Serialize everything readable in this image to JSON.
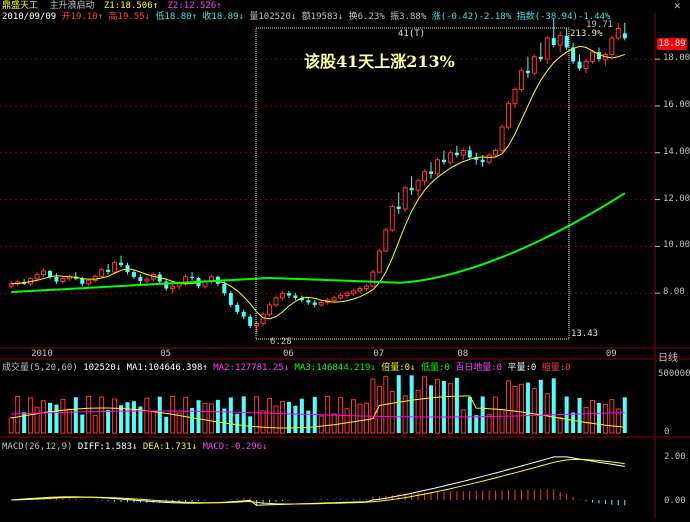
{
  "header": {
    "stock_name": "鼎盛天工",
    "indicator_name": "主升浪启动",
    "z1": "Z1:18.506↑",
    "z2": "Z2:12.526↑",
    "date": "2010/09/09",
    "open": "开19.10↑",
    "high": "高19.55↓",
    "low": "低18.80↑",
    "close": "收18.89↓",
    "volume": "量102520↓",
    "amount": "额19583↓",
    "turnover": "换6.23%",
    "amplitude": "振3.88%",
    "change": "涨(-0.42)-2.18%",
    "index": "指数(-38.94)-1.44%"
  },
  "annotation": {
    "title": "该股41天上涨213%",
    "days_label": "41(T)",
    "pct_label": "213.9%",
    "high_value": "19.71",
    "low_value": "6.28",
    "bottom_value": "13.43"
  },
  "price_tag": "18.89",
  "price_axis_labels": [
    "18.00",
    "16.00",
    "14.00",
    "12.00",
    "10.00",
    "8.00"
  ],
  "date_axis": {
    "labels": [
      "2010",
      "05",
      "06",
      "07",
      "08",
      "09"
    ],
    "period_label": "日线"
  },
  "volume_header": {
    "name": "成交量(5,20,60)",
    "value": "102520↓",
    "ma1": "MA1:104646.398↑",
    "ma2": "MA2:127781.25↓",
    "ma3": "MA3:146844.219↓",
    "bei": "倍量:0↓",
    "di": "低量:0",
    "bai": "百日地量:0",
    "ping": "平量:0",
    "suo": "缩量:0"
  },
  "volume_axis_labels": [
    "500000",
    "0"
  ],
  "macd_header": {
    "name": "MACD(26,12,9)",
    "diff": "DIFF:1.583↓",
    "dea": "DEA:1.731↓",
    "macd": "MACD:-0.296↓"
  },
  "macd_axis_labels": [
    "2.00",
    "0.00"
  ],
  "colors": {
    "up": "#ff3232",
    "down": "#54fcfc",
    "ma_yellow": "#ffff00",
    "ma_green": "#00ff00",
    "ma_purple": "#ff00ff",
    "grid": "#8b0000",
    "annotation_box": "#e8e8b0"
  },
  "chart_data": {
    "type": "candlestick",
    "x_axis_labels": [
      "2010",
      "05",
      "06",
      "07",
      "08",
      "09"
    ],
    "y_axis_ticks": [
      8,
      10,
      12,
      14,
      16,
      18
    ],
    "ylim": [
      6,
      19.8
    ],
    "ohlc": [
      [
        8.3,
        8.52,
        8.2,
        8.4
      ],
      [
        8.4,
        8.55,
        8.3,
        8.48
      ],
      [
        8.48,
        8.6,
        8.35,
        8.4
      ],
      [
        8.4,
        8.7,
        8.3,
        8.62
      ],
      [
        8.62,
        8.9,
        8.5,
        8.8
      ],
      [
        8.8,
        9.05,
        8.7,
        8.95
      ],
      [
        8.95,
        9.0,
        8.6,
        8.7
      ],
      [
        8.7,
        8.85,
        8.4,
        8.5
      ],
      [
        8.5,
        8.7,
        8.4,
        8.62
      ],
      [
        8.62,
        8.8,
        8.5,
        8.7
      ],
      [
        8.7,
        8.9,
        8.55,
        8.62
      ],
      [
        8.62,
        8.7,
        8.3,
        8.4
      ],
      [
        8.4,
        8.6,
        8.3,
        8.55
      ],
      [
        8.55,
        8.8,
        8.45,
        8.72
      ],
      [
        8.72,
        9.1,
        8.65,
        9.0
      ],
      [
        9.0,
        9.25,
        8.8,
        8.9
      ],
      [
        8.9,
        9.4,
        8.85,
        9.3
      ],
      [
        9.3,
        9.6,
        9.1,
        9.2
      ],
      [
        9.2,
        9.3,
        8.8,
        8.9
      ],
      [
        8.9,
        9.0,
        8.6,
        8.7
      ],
      [
        8.7,
        8.8,
        8.4,
        8.52
      ],
      [
        8.52,
        8.7,
        8.3,
        8.6
      ],
      [
        8.6,
        8.9,
        8.5,
        8.8
      ],
      [
        8.8,
        8.9,
        8.4,
        8.5
      ],
      [
        8.5,
        8.6,
        8.1,
        8.2
      ],
      [
        8.2,
        8.4,
        8.0,
        8.3
      ],
      [
        8.3,
        8.5,
        8.15,
        8.4
      ],
      [
        8.4,
        8.8,
        8.3,
        8.7
      ],
      [
        8.7,
        8.9,
        8.55,
        8.65
      ],
      [
        8.65,
        8.7,
        8.2,
        8.3
      ],
      [
        8.3,
        8.6,
        8.2,
        8.5
      ],
      [
        8.5,
        8.8,
        8.4,
        8.7
      ],
      [
        8.7,
        8.75,
        8.3,
        8.4
      ],
      [
        8.4,
        8.5,
        7.9,
        8.0
      ],
      [
        8.0,
        8.1,
        7.4,
        7.5
      ],
      [
        7.5,
        7.6,
        7.1,
        7.2
      ],
      [
        7.2,
        7.3,
        6.9,
        7.0
      ],
      [
        7.0,
        7.1,
        6.5,
        6.6
      ],
      [
        6.6,
        6.8,
        6.28,
        6.7
      ],
      [
        6.7,
        7.2,
        6.6,
        7.1
      ],
      [
        7.1,
        7.6,
        7.0,
        7.5
      ],
      [
        7.5,
        7.9,
        7.4,
        7.8
      ],
      [
        7.8,
        8.1,
        7.7,
        8.0
      ],
      [
        8.0,
        8.1,
        7.8,
        7.9
      ],
      [
        7.9,
        8.0,
        7.7,
        7.8
      ],
      [
        7.8,
        7.9,
        7.6,
        7.7
      ],
      [
        7.7,
        7.8,
        7.5,
        7.6
      ],
      [
        7.6,
        7.7,
        7.4,
        7.5
      ],
      [
        7.5,
        7.7,
        7.4,
        7.6
      ],
      [
        7.6,
        7.8,
        7.5,
        7.7
      ],
      [
        7.7,
        7.9,
        7.6,
        7.8
      ],
      [
        7.8,
        8.0,
        7.7,
        7.9
      ],
      [
        7.9,
        8.1,
        7.8,
        8.0
      ],
      [
        8.0,
        8.2,
        7.9,
        8.1
      ],
      [
        8.1,
        8.3,
        8.0,
        8.2
      ],
      [
        8.2,
        8.4,
        8.1,
        8.3
      ],
      [
        8.3,
        9.0,
        8.25,
        8.9
      ],
      [
        8.9,
        9.9,
        8.85,
        9.8
      ],
      [
        9.8,
        10.8,
        9.75,
        10.7
      ],
      [
        10.7,
        11.8,
        10.6,
        11.7
      ],
      [
        11.7,
        12.3,
        11.4,
        11.6
      ],
      [
        11.6,
        12.6,
        11.5,
        12.5
      ],
      [
        12.5,
        13.0,
        12.2,
        12.4
      ],
      [
        12.4,
        12.9,
        12.1,
        12.8
      ],
      [
        12.8,
        13.3,
        12.6,
        13.2
      ],
      [
        13.2,
        13.6,
        12.9,
        13.1
      ],
      [
        13.1,
        13.8,
        13.0,
        13.7
      ],
      [
        13.7,
        14.1,
        13.5,
        13.6
      ],
      [
        13.6,
        14.1,
        13.5,
        14.0
      ],
      [
        14.0,
        14.3,
        13.8,
        13.9
      ],
      [
        13.9,
        14.2,
        13.7,
        14.1
      ],
      [
        14.1,
        14.3,
        13.7,
        13.8
      ],
      [
        13.8,
        14.0,
        13.5,
        13.7
      ],
      [
        13.7,
        13.9,
        13.4,
        13.6
      ],
      [
        13.6,
        14.0,
        13.5,
        13.9
      ],
      [
        13.9,
        14.2,
        13.8,
        14.1
      ],
      [
        14.1,
        15.2,
        14.0,
        15.1
      ],
      [
        15.1,
        16.2,
        15.0,
        16.1
      ],
      [
        16.1,
        16.8,
        15.9,
        16.7
      ],
      [
        16.7,
        17.6,
        16.6,
        17.5
      ],
      [
        17.5,
        18.1,
        17.2,
        17.4
      ],
      [
        17.4,
        18.2,
        17.3,
        18.1
      ],
      [
        18.1,
        18.7,
        17.9,
        18.0
      ],
      [
        18.0,
        19.0,
        17.8,
        18.9
      ],
      [
        18.9,
        19.71,
        18.5,
        18.6
      ],
      [
        18.6,
        19.2,
        18.3,
        19.0
      ],
      [
        19.0,
        19.3,
        18.4,
        18.5
      ],
      [
        18.5,
        18.7,
        17.8,
        17.9
      ],
      [
        17.9,
        18.2,
        17.5,
        17.6
      ],
      [
        17.6,
        18.0,
        17.4,
        17.9
      ],
      [
        17.9,
        18.4,
        17.8,
        18.3
      ],
      [
        18.3,
        18.5,
        17.9,
        18.0
      ],
      [
        18.0,
        18.3,
        17.7,
        18.2
      ],
      [
        18.2,
        19.0,
        18.1,
        18.9
      ],
      [
        18.9,
        19.55,
        18.8,
        19.31
      ],
      [
        19.1,
        19.55,
        18.8,
        18.89
      ]
    ],
    "ma_short": [
      8.4,
      8.42,
      8.45,
      8.5,
      8.55,
      8.62,
      8.7,
      8.75,
      8.72,
      8.7,
      8.68,
      8.62,
      8.6,
      8.6,
      8.65,
      8.72,
      8.85,
      8.98,
      9.05,
      9.0,
      8.9,
      8.8,
      8.72,
      8.66,
      8.6,
      8.5,
      8.42,
      8.4,
      8.42,
      8.45,
      8.5,
      8.52,
      8.5,
      8.45,
      8.3,
      8.1,
      7.85,
      7.55,
      7.2,
      6.95,
      6.9,
      7.0,
      7.2,
      7.45,
      7.65,
      7.8,
      7.82,
      7.78,
      7.7,
      7.65,
      7.62,
      7.63,
      7.68,
      7.75,
      7.85,
      7.98,
      8.15,
      8.45,
      8.9,
      9.5,
      10.2,
      10.9,
      11.5,
      12.0,
      12.4,
      12.7,
      12.95,
      13.15,
      13.35,
      13.5,
      13.62,
      13.72,
      13.8,
      13.82,
      13.8,
      13.82,
      13.95,
      14.3,
      14.8,
      15.4,
      16.0,
      16.6,
      17.1,
      17.5,
      17.85,
      18.1,
      18.3,
      18.45,
      18.55,
      18.5,
      18.35,
      18.2,
      18.1,
      18.05,
      18.1,
      18.2
    ]
  }
}
